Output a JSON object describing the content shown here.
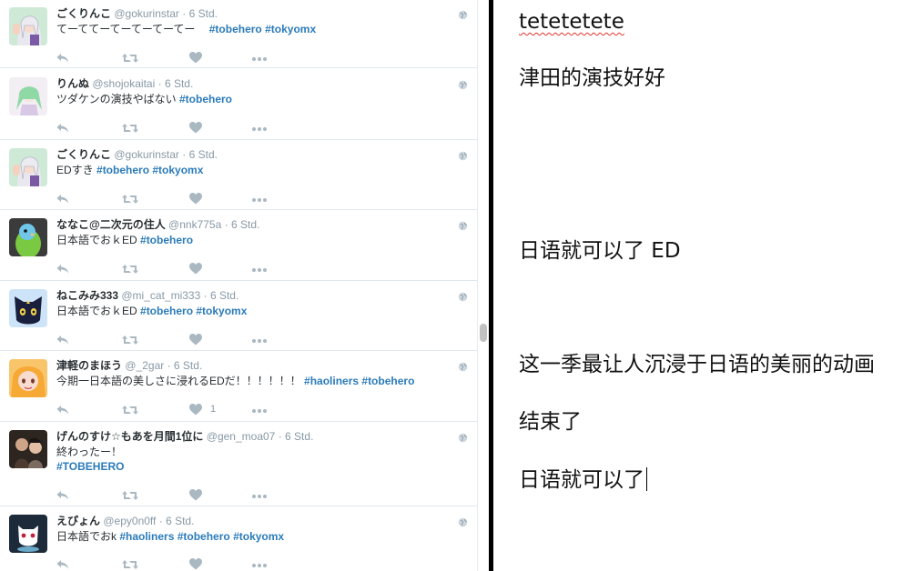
{
  "timeline": {
    "tweets": [
      {
        "name": "ごくりんこ",
        "handle": "@gokurinstar",
        "dot": "·",
        "time": "6 Std.",
        "lines": [
          [
            {
              "t": "てーててーてーてーてーてー　 ",
              "tag": false
            },
            {
              "t": "#tobehero",
              "tag": true
            },
            {
              "t": " ",
              "tag": false
            },
            {
              "t": "#tokyomx",
              "tag": true
            }
          ]
        ],
        "likes": "",
        "avatar": "anime-girl-thumbsup"
      },
      {
        "name": "りんぬ",
        "handle": "@shojokaitai",
        "dot": "·",
        "time": "6 Std.",
        "lines": [
          [
            {
              "t": "ツダケンの演技やばない ",
              "tag": false
            },
            {
              "t": "#tobehero",
              "tag": true
            }
          ]
        ],
        "likes": "",
        "avatar": "anime-girl-green-hair"
      },
      {
        "name": "ごくりんこ",
        "handle": "@gokurinstar",
        "dot": "·",
        "time": "6 Std.",
        "lines": [
          [
            {
              "t": "EDすき ",
              "tag": false
            },
            {
              "t": "#tobehero",
              "tag": true
            },
            {
              "t": " ",
              "tag": false
            },
            {
              "t": "#tokyomx",
              "tag": true
            }
          ]
        ],
        "likes": "",
        "avatar": "anime-girl-thumbsup"
      },
      {
        "name": "ななこ@二次元の住人",
        "handle": "@nnk775a",
        "dot": "·",
        "time": "6 Std.",
        "lines": [
          [
            {
              "t": "日本語でおｋED ",
              "tag": false
            },
            {
              "t": "#tobehero",
              "tag": true
            }
          ]
        ],
        "likes": "",
        "avatar": "green-parakeet"
      },
      {
        "name": "ねこみみ333",
        "handle": "@mi_cat_mi333",
        "dot": "·",
        "time": "6 Std.",
        "lines": [
          [
            {
              "t": "日本語でおｋED ",
              "tag": false
            },
            {
              "t": "#tobehero",
              "tag": true
            },
            {
              "t": " ",
              "tag": false
            },
            {
              "t": "#tokyomx",
              "tag": true
            }
          ]
        ],
        "likes": "",
        "avatar": "black-cat-luna"
      },
      {
        "name": "津軽のまほう",
        "handle": "@_2gar",
        "dot": "·",
        "time": "6 Std.",
        "lines": [
          [
            {
              "t": "今期一日本語の美しさに浸れるEDだ！！！！！！ ",
              "tag": false
            },
            {
              "t": "#haoliners",
              "tag": true
            },
            {
              "t": " ",
              "tag": false
            },
            {
              "t": "#tobehero",
              "tag": true
            }
          ]
        ],
        "likes": "1",
        "avatar": "anime-girl-blonde"
      },
      {
        "name": "げんのすけ☆もあを月間1位に",
        "handle": "@gen_moa07",
        "dot": "·",
        "time": "6 Std.",
        "lines": [
          [
            {
              "t": "終わったー！",
              "tag": false
            }
          ],
          [
            {
              "t": "#TOBEHERO",
              "tag": true
            }
          ]
        ],
        "likes": "",
        "avatar": "photo-people"
      },
      {
        "name": "えぴょん",
        "handle": "@epy0n0ff",
        "dot": "·",
        "time": "6 Std.",
        "lines": [
          [
            {
              "t": "日本語でおk ",
              "tag": false
            },
            {
              "t": "#haoliners",
              "tag": true
            },
            {
              "t": " ",
              "tag": false
            },
            {
              "t": "#tobehero",
              "tag": true
            },
            {
              "t": " ",
              "tag": false
            },
            {
              "t": "#tokyomx",
              "tag": true
            }
          ]
        ],
        "likes": "",
        "avatar": "white-cat-mascot"
      }
    ],
    "icons": [
      "reply-icon",
      "retweet-icon",
      "like-icon",
      "more-icon",
      "globe-icon"
    ],
    "colors": {
      "hashtag": "#2b7bb9",
      "meta": "#8899a6",
      "icon": "#aab8c2"
    }
  },
  "editor": {
    "lines": [
      "tetetetete",
      "津田的演技好好",
      "日语就可以了 ED",
      "这一季最让人沉浸于日语的美丽的动画",
      "结束了",
      "日语就可以了"
    ]
  }
}
